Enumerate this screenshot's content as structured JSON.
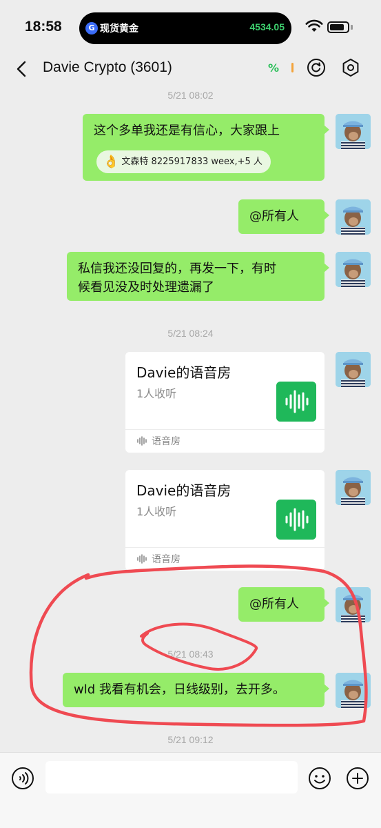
{
  "status_bar": {
    "time": "18:58",
    "ticker_icon": "G",
    "ticker_name": "现货黄金",
    "ticker_price": "4534.05"
  },
  "header": {
    "title": "Davie Crypto (3601)",
    "indicator": "%"
  },
  "messages": {
    "ts1": "5/21 08:02",
    "msg1": "这个多单我还是有信心，大家跟上",
    "reaction_emoji": "👌",
    "reaction": "文森特 8225917833 weex,+5 人",
    "msg2": "@所有人",
    "msg3_line1": "私信我还没回复的，再发一下，有时",
    "msg3_line2": "候看见没及时处理遗漏了",
    "ts2": "5/21 08:24",
    "card1_title": "Davie的语音房",
    "card1_sub": "1人收听",
    "card1_foot": "语音房",
    "card2_title": "Davie的语音房",
    "card2_sub": "1人收听",
    "card2_foot": "语音房",
    "msg4": "@所有人",
    "ts3": "5/21 08:43",
    "msg5": "wld 我看有机会，日线级别，去开多。",
    "ts4": "5/21 09:12"
  },
  "input_bar": {
    "placeholder": ""
  },
  "colors": {
    "outgoing_bubble": "#95ec69",
    "voice_room_icon": "#1fb85a",
    "annotation": "#ef4a52",
    "price_green": "#3ecf6e"
  }
}
